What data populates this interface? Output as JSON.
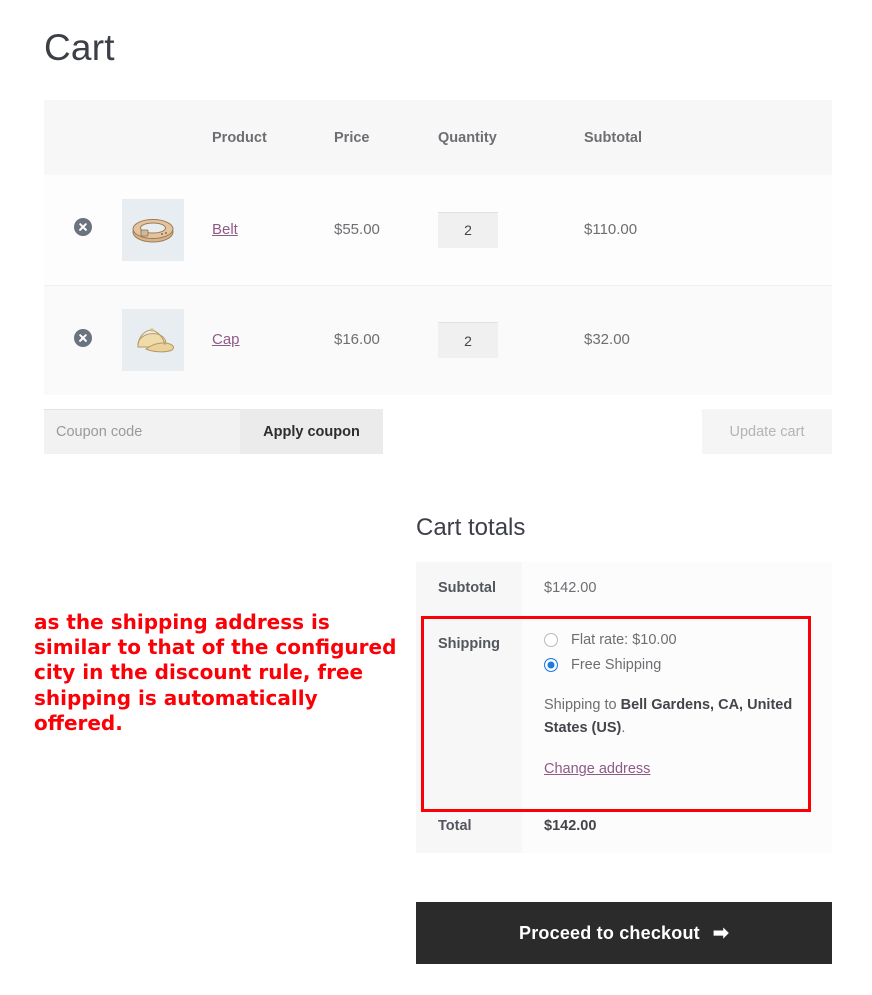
{
  "page": {
    "title": "Cart"
  },
  "cart_table": {
    "columns": [
      "",
      "",
      "Product",
      "Price",
      "Quantity",
      "Subtotal"
    ],
    "headers": {
      "product": "Product",
      "price": "Price",
      "quantity": "Quantity",
      "subtotal": "Subtotal"
    },
    "rows": [
      {
        "remove_icon": "remove-circle-x-icon",
        "thumbnail": "belt-product-thumbnail",
        "name": "Belt",
        "price": "$55.00",
        "quantity": "2",
        "subtotal": "$110.00"
      },
      {
        "remove_icon": "remove-circle-x-icon",
        "thumbnail": "cap-product-thumbnail",
        "name": "Cap",
        "price": "$16.00",
        "quantity": "2",
        "subtotal": "$32.00"
      }
    ]
  },
  "coupon": {
    "placeholder": "Coupon code",
    "value": "",
    "apply_label": "Apply coupon",
    "update_label": "Update cart"
  },
  "annotation": {
    "text": "as the shipping address is similar to that of the configured city in the discount rule, free shipping is automatically offered.",
    "color": "#fb0007"
  },
  "cart_totals": {
    "title": "Cart totals",
    "subtotal_label": "Subtotal",
    "subtotal_value": "$142.00",
    "shipping_label": "Shipping",
    "shipping_options": [
      {
        "label": "Flat rate: $10.00",
        "selected": false
      },
      {
        "label": "Free Shipping",
        "selected": true
      }
    ],
    "shipping_to_prefix": "Shipping to ",
    "shipping_to_address": "Bell Gardens, CA, United States (US)",
    "shipping_to_suffix": ".",
    "change_address_label": "Change address",
    "total_label": "Total",
    "total_value": "$142.00",
    "selected_radio_color": "#1e7ae0"
  },
  "checkout": {
    "label": "Proceed to checkout",
    "arrow": "➡",
    "background": "#2b2b2b"
  }
}
